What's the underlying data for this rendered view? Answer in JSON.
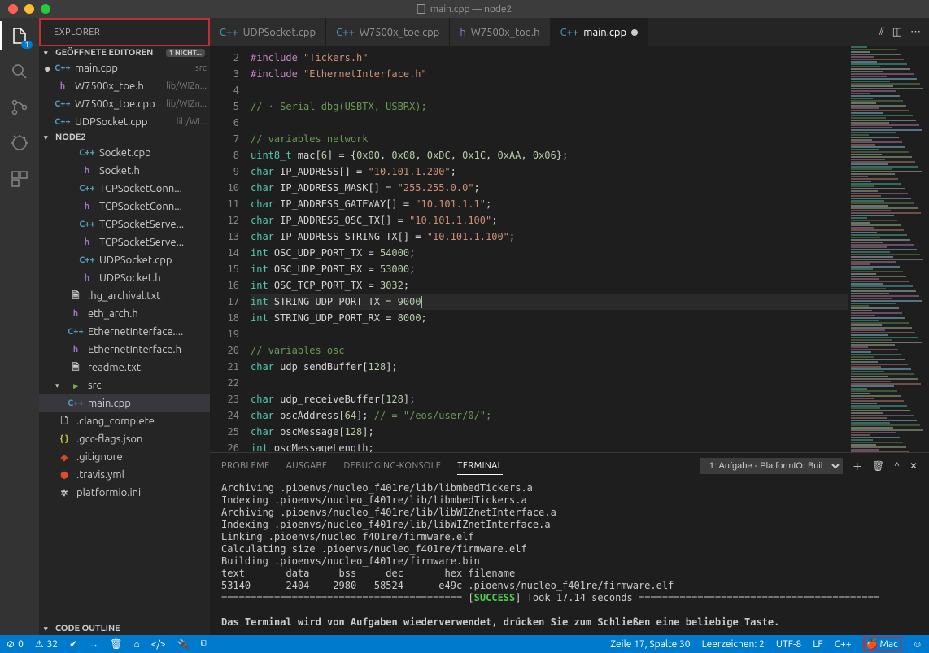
{
  "titlebar": {
    "filename": "main.cpp",
    "project": "node2"
  },
  "activity": {
    "badge_count": "1"
  },
  "sidebar": {
    "title": "EXPLORER",
    "sections": {
      "open_editors": {
        "label": "GEÖFFNETE EDITOREN",
        "badge": "1 NICHT..."
      },
      "project": {
        "label": "NODE2"
      },
      "outline": {
        "label": "CODE OUTLINE"
      }
    },
    "open_editors_items": [
      {
        "mod": true,
        "lang": "C++",
        "cls": "lang-cpp",
        "name": "main.cpp",
        "desc": "src"
      },
      {
        "mod": false,
        "lang": "h",
        "cls": "lang-h",
        "name": "W7500x_toe.h",
        "desc": "lib/WIZn..."
      },
      {
        "mod": false,
        "lang": "C++",
        "cls": "lang-cpp",
        "name": "W7500x_toe.cpp",
        "desc": "lib/WIZn..."
      },
      {
        "mod": false,
        "lang": "C++",
        "cls": "lang-cpp",
        "name": "UDPSocket.cpp",
        "desc": "lib/WI..."
      }
    ],
    "tree": [
      {
        "indent": 3,
        "lang": "C++",
        "cls": "lang-cpp",
        "name": "Socket.cpp"
      },
      {
        "indent": 3,
        "lang": "h",
        "cls": "lang-h",
        "name": "Socket.h"
      },
      {
        "indent": 3,
        "lang": "C++",
        "cls": "lang-cpp",
        "name": "TCPSocketConn..."
      },
      {
        "indent": 3,
        "lang": "h",
        "cls": "lang-h",
        "name": "TCPSocketConn..."
      },
      {
        "indent": 3,
        "lang": "C++",
        "cls": "lang-cpp",
        "name": "TCPSocketServe..."
      },
      {
        "indent": 3,
        "lang": "h",
        "cls": "lang-h",
        "name": "TCPSocketServe..."
      },
      {
        "indent": 3,
        "lang": "C++",
        "cls": "lang-cpp",
        "name": "UDPSocket.cpp"
      },
      {
        "indent": 3,
        "lang": "h",
        "cls": "lang-h",
        "name": "UDPSocket.h"
      },
      {
        "indent": 2,
        "lang": "🗎",
        "cls": "lang-txt",
        "name": ".hg_archival.txt"
      },
      {
        "indent": 2,
        "lang": "h",
        "cls": "lang-h",
        "name": "eth_arch.h"
      },
      {
        "indent": 2,
        "lang": "C++",
        "cls": "lang-cpp",
        "name": "EthernetInterface...."
      },
      {
        "indent": 2,
        "lang": "h",
        "cls": "lang-h",
        "name": "EthernetInterface.h"
      },
      {
        "indent": 2,
        "lang": "🗎",
        "cls": "lang-txt",
        "name": "readme.txt"
      },
      {
        "indent": 1,
        "lang": "▸",
        "cls": "lang-folder",
        "name": "src",
        "folder": true,
        "open": true
      },
      {
        "indent": 2,
        "lang": "C++",
        "cls": "lang-cpp",
        "name": "main.cpp",
        "selected": true
      },
      {
        "indent": 1,
        "lang": "🗋",
        "cls": "lang-txt",
        "name": ".clang_complete"
      },
      {
        "indent": 1,
        "lang": "{ }",
        "cls": "lang-json",
        "name": ".gcc-flags.json"
      },
      {
        "indent": 1,
        "lang": "◈",
        "cls": "lang-git",
        "name": ".gitignore"
      },
      {
        "indent": 1,
        "lang": "⬢",
        "cls": "lang-yml",
        "name": ".travis.yml"
      },
      {
        "indent": 1,
        "lang": "✲",
        "cls": "lang-pio",
        "name": "platformio.ini"
      }
    ]
  },
  "tabs": [
    {
      "lang": "C++",
      "label": "main.cpp",
      "active": true,
      "modified": true
    },
    {
      "lang": "h",
      "label": "W7500x_toe.h",
      "active": false
    },
    {
      "lang": "C++",
      "label": "W7500x_toe.cpp",
      "active": false
    },
    {
      "lang": "C++",
      "label": "UDPSocket.cpp",
      "active": false
    }
  ],
  "editor": {
    "first_line": 2,
    "highlight_line": 17,
    "lines": [
      [
        [
          "pp",
          "#include "
        ],
        [
          "st",
          "\"Tickers.h\""
        ]
      ],
      [
        [
          "pp",
          "#include "
        ],
        [
          "st",
          "\"EthernetInterface.h\""
        ]
      ],
      [],
      [
        [
          "co",
          "// · Serial dbg(USBTX, USBRX);"
        ]
      ],
      [],
      [
        [
          "co",
          "// variables network"
        ]
      ],
      [
        [
          "ty",
          "uint8_t"
        ],
        [
          "op",
          " mac["
        ],
        [
          "nu",
          "6"
        ],
        [
          "op",
          "] = {"
        ],
        [
          "nu",
          "0x00"
        ],
        [
          "op",
          ", "
        ],
        [
          "nu",
          "0x08"
        ],
        [
          "op",
          ", "
        ],
        [
          "nu",
          "0xDC"
        ],
        [
          "op",
          ", "
        ],
        [
          "nu",
          "0x1C"
        ],
        [
          "op",
          ", "
        ],
        [
          "nu",
          "0xAA"
        ],
        [
          "op",
          ", "
        ],
        [
          "nu",
          "0x06"
        ],
        [
          "op",
          "};"
        ]
      ],
      [
        [
          "ty",
          "char"
        ],
        [
          "op",
          " IP_ADDRESS[] = "
        ],
        [
          "st",
          "\"10.101.1.200\""
        ],
        [
          "op",
          ";"
        ]
      ],
      [
        [
          "ty",
          "char"
        ],
        [
          "op",
          " IP_ADDRESS_MASK[] = "
        ],
        [
          "st",
          "\"255.255.0.0\""
        ],
        [
          "op",
          ";"
        ]
      ],
      [
        [
          "ty",
          "char"
        ],
        [
          "op",
          " IP_ADDRESS_GATEWAY[] = "
        ],
        [
          "st",
          "\"10.101.1.1\""
        ],
        [
          "op",
          ";"
        ]
      ],
      [
        [
          "ty",
          "char"
        ],
        [
          "op",
          " IP_ADDRESS_OSC_TX[] = "
        ],
        [
          "st",
          "\"10.101.1.100\""
        ],
        [
          "op",
          ";"
        ]
      ],
      [
        [
          "ty",
          "char"
        ],
        [
          "op",
          " IP_ADDRESS_STRING_TX[] = "
        ],
        [
          "st",
          "\"10.101.1.100\""
        ],
        [
          "op",
          ";"
        ]
      ],
      [
        [
          "ty",
          "int"
        ],
        [
          "op",
          " OSC_UDP_PORT_TX = "
        ],
        [
          "nu",
          "54000"
        ],
        [
          "op",
          ";"
        ]
      ],
      [
        [
          "ty",
          "int"
        ],
        [
          "op",
          " OSC_UDP_PORT_RX = "
        ],
        [
          "nu",
          "53000"
        ],
        [
          "op",
          ";"
        ]
      ],
      [
        [
          "ty",
          "int"
        ],
        [
          "op",
          " OSC_TCP_PORT_TX = "
        ],
        [
          "nu",
          "3032"
        ],
        [
          "op",
          ";"
        ]
      ],
      [
        [
          "ty",
          "int"
        ],
        [
          "op",
          " STRING_UDP_PORT_TX = "
        ],
        [
          "nu",
          "9000"
        ],
        [
          "cursor",
          ""
        ]
      ],
      [
        [
          "ty",
          "int"
        ],
        [
          "op",
          " STRING_UDP_PORT_RX = "
        ],
        [
          "nu",
          "8000"
        ],
        [
          "op",
          ";"
        ]
      ],
      [],
      [
        [
          "co",
          "// variables osc"
        ]
      ],
      [
        [
          "ty",
          "char"
        ],
        [
          "op",
          " udp_sendBuffer["
        ],
        [
          "nu",
          "128"
        ],
        [
          "op",
          "];"
        ]
      ],
      [],
      [
        [
          "ty",
          "char"
        ],
        [
          "op",
          " udp_receiveBuffer["
        ],
        [
          "nu",
          "128"
        ],
        [
          "op",
          "];"
        ]
      ],
      [
        [
          "ty",
          "char"
        ],
        [
          "op",
          " oscAddress["
        ],
        [
          "nu",
          "64"
        ],
        [
          "op",
          "]; "
        ],
        [
          "co",
          "// = \"/eos/user/0/\";"
        ]
      ],
      [
        [
          "ty",
          "char"
        ],
        [
          "op",
          " oscMessage["
        ],
        [
          "nu",
          "128"
        ],
        [
          "op",
          "];"
        ]
      ],
      [
        [
          "ty",
          "int"
        ],
        [
          "op",
          " oscMessageLength;"
        ]
      ]
    ]
  },
  "panel": {
    "tabs": [
      "PROBLEME",
      "AUSGABE",
      "DEBUGGING-KONSOLE",
      "TERMINAL"
    ],
    "active_tab": 3,
    "selector": "1: Aufgabe - PlatformIO: Buil",
    "terminal_lines": [
      "Archiving .pioenvs/nucleo_f401re/lib/libmbedTickers.a",
      "Indexing .pioenvs/nucleo_f401re/lib/libmbedTickers.a",
      "Archiving .pioenvs/nucleo_f401re/lib/libWIZnetInterface.a",
      "Indexing .pioenvs/nucleo_f401re/lib/libWIZnetInterface.a",
      "Linking .pioenvs/nucleo_f401re/firmware.elf",
      "Calculating size .pioenvs/nucleo_f401re/firmware.elf",
      "Building .pioenvs/nucleo_f401re/firmware.bin",
      "text       data     bss     dec       hex filename",
      "53140      2404    2980   58524      e49c .pioenvs/nucleo_f401re/firmware.elf"
    ],
    "success_prefix": "========================================= [",
    "success_word": "SUCCESS",
    "success_suffix": "] Took 17.14 seconds =========================================",
    "footer": "Das Terminal wird von Aufgaben wiederverwendet, drücken Sie zum Schließen eine beliebige Taste."
  },
  "status": {
    "errors": "0",
    "warnings": "32",
    "cursor": "Zeile 17, Spalte 30",
    "spaces": "Leerzeichen: 2",
    "encoding": "UTF-8",
    "eol": "LF",
    "lang": "C++",
    "mac": "Mac"
  }
}
